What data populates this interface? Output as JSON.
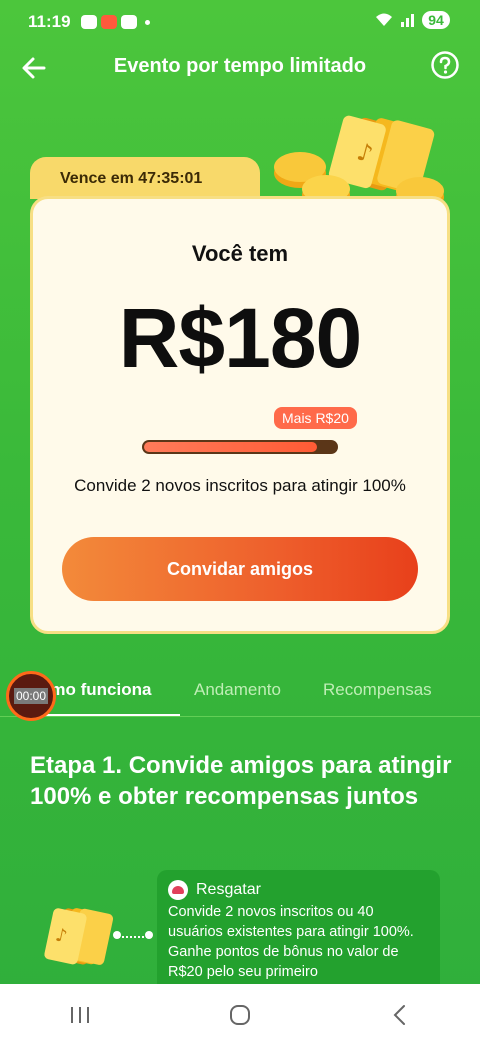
{
  "status_bar": {
    "time": "11:19",
    "battery": "94"
  },
  "header": {
    "title": "Evento por tempo limitado",
    "back_icon": "arrow-left-icon",
    "help_icon": "question-circle-icon"
  },
  "card": {
    "countdown": "Vence em 47:35:01",
    "heading": "Você tem",
    "amount": "R$180",
    "bonus_chip": "Mais R$20",
    "progress_fraction": 0.9,
    "invite_text": "Convide 2 novos inscritos para atingir 100%",
    "invite_button": "Convidar amigos"
  },
  "tabs": [
    {
      "label": "omo funciona",
      "active": true
    },
    {
      "label": "Andamento",
      "active": false
    },
    {
      "label": "Recompensas",
      "active": false
    }
  ],
  "timer_overlay": "00:00",
  "step": {
    "title": "Etapa 1. Convide amigos para atingir 100% e obter recompensas juntos",
    "box_label": "Resgatar",
    "box_text": "Convide 2 novos inscritos ou 40 usuários existentes para atingir 100%. Ganhe pontos de bônus no valor de R$20 pelo seu primeiro"
  },
  "colors": {
    "background": "#3ab93a",
    "accent_orange": "#ee5f2c",
    "card_bg": "#fffaea",
    "tab_yellow": "#f8d96a"
  }
}
